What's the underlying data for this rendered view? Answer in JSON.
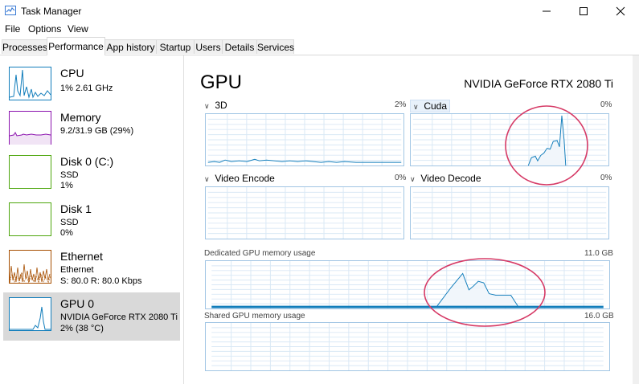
{
  "window": {
    "title": "Task Manager",
    "minimize_icon": "minimize-icon",
    "maximize_icon": "maximize-icon",
    "close_icon": "close-icon"
  },
  "menu": [
    "File",
    "Options",
    "View"
  ],
  "tabs": [
    "Processes",
    "Performance",
    "App history",
    "Startup",
    "Users",
    "Details",
    "Services"
  ],
  "active_tab": "Performance",
  "sidebar": [
    {
      "title": "CPU",
      "sub": [
        "1% 2.61 GHz"
      ],
      "color": "#117dbb"
    },
    {
      "title": "Memory",
      "sub": [
        "9.2/31.9 GB (29%)"
      ],
      "color": "#8b12ae"
    },
    {
      "title": "Disk 0 (C:)",
      "sub": [
        "SSD",
        "1%"
      ],
      "color": "#4da60c"
    },
    {
      "title": "Disk 1",
      "sub": [
        "SSD",
        "0%"
      ],
      "color": "#4da60c"
    },
    {
      "title": "Ethernet",
      "sub": [
        "Ethernet",
        "S: 80.0 R: 80.0 Kbps"
      ],
      "color": "#a74f01"
    },
    {
      "title": "GPU 0",
      "sub": [
        "NVIDIA GeForce RTX 2080 Ti",
        "2% (38 °C)"
      ],
      "color": "#117dbb"
    }
  ],
  "gpu": {
    "title": "GPU",
    "model": "NVIDIA GeForce RTX 2080 Ti",
    "engines": [
      {
        "label": "3D",
        "pct": "2%"
      },
      {
        "label": "Cuda",
        "pct": "0%"
      },
      {
        "label": "Video Encode",
        "pct": "0%"
      },
      {
        "label": "Video Decode",
        "pct": "0%"
      }
    ],
    "dedicated": {
      "label": "Dedicated GPU memory usage",
      "max": "11.0 GB"
    },
    "shared": {
      "label": "Shared GPU memory usage",
      "max": "16.0 GB"
    },
    "graph_color": "#117dbb",
    "annotation_color": "#d63a66"
  }
}
